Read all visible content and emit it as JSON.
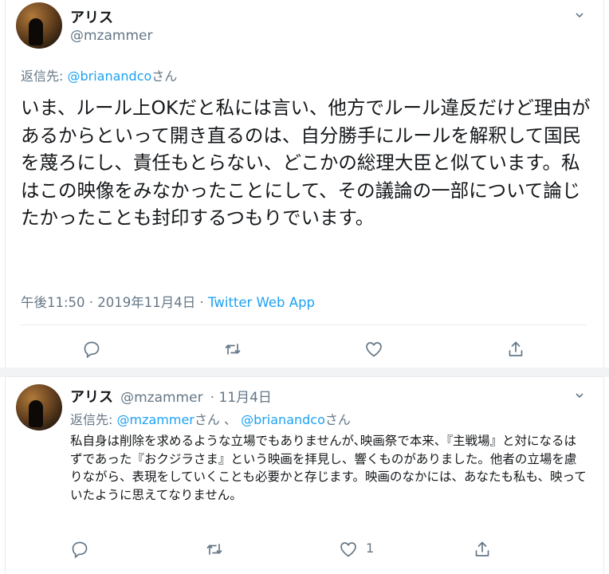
{
  "main_tweet": {
    "display_name": "アリス",
    "handle": "@mzammer",
    "reply_prefix": "返信先: ",
    "reply_to": "@brianandco",
    "reply_suffix": "さん",
    "text": "いま、ルール上OKだと私には言い、他方でルール違反だけど理由があるからといって開き直るのは、自分勝手にルールを解釈して国民を蔑ろにし、責任もとらない、どこかの総理大臣と似ています。私はこの映像をみなかったことにして、その議論の一部について論じたかったことも封印するつもりでいます。",
    "timestamp": "午後11:50 · 2019年11月4日 · ",
    "source": "Twitter Web App",
    "actions": {
      "reply_icon": "reply-icon",
      "retweet_icon": "retweet-icon",
      "like_icon": "heart-icon",
      "share_icon": "share-icon"
    }
  },
  "reply_tweet": {
    "display_name": "アリス",
    "handle": "@mzammer",
    "date": "· 11月4日",
    "reply_prefix": "返信先: ",
    "reply_to_1": "@mzammer",
    "reply_sep": "さん 、 ",
    "reply_to_2": "@brianandco",
    "reply_suffix": "さん",
    "text": "私自身は削除を求めるような立場でもありませんが､映画祭で本来、『主戦場』と対になるはずであった『おクジラさま』という映画を拝見し、響くものがありました。他者の立場を慮りながら、表現をしていくことも必要かと存じます。映画のなかには、あなたも私も、映っていたように思えてなりません。",
    "like_count": "1"
  },
  "colors": {
    "link": "#1da1f2",
    "secondary": "#657786",
    "text": "#14171a",
    "border": "#e6ecf0"
  }
}
